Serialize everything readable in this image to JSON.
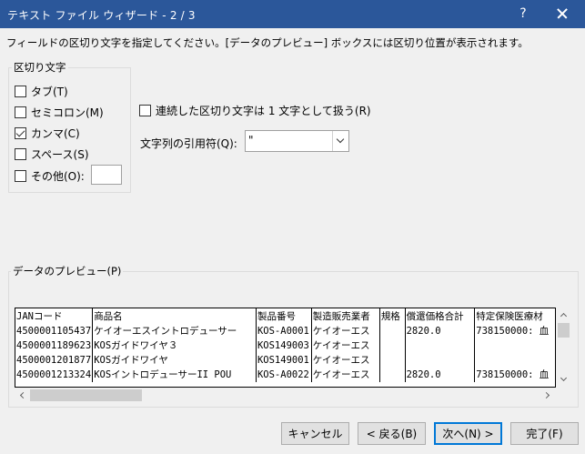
{
  "window": {
    "title": "テキスト ファイル ウィザード - 2 / 3",
    "help_label": "?"
  },
  "instruction": "フィールドの区切り文字を指定してください。[データのプレビュー] ボックスには区切り位置が表示されます。",
  "delimiters": {
    "group_label": "区切り文字",
    "tab": {
      "label": "タブ(T)",
      "checked": false
    },
    "semicolon": {
      "label": "セミコロン(M)",
      "checked": false
    },
    "comma": {
      "label": "カンマ(C)",
      "checked": true
    },
    "space": {
      "label": "スペース(S)",
      "checked": false
    },
    "other": {
      "label": "その他(O):",
      "checked": false,
      "value": ""
    }
  },
  "consecutive": {
    "label": "連続した区切り文字は 1 文字として扱う(R)",
    "checked": false
  },
  "qualifier": {
    "label": "文字列の引用符(Q):",
    "value": "\""
  },
  "preview": {
    "label": "データのプレビュー(P)",
    "rows": [
      [
        "JANコード",
        "商品名",
        "製品番号",
        "製造販売業者",
        "規格",
        "償還価格合計",
        "特定保険医療材"
      ],
      [
        "4500001105437",
        "ケイオーエスイントロデューサー",
        "KOS-A0001",
        "ケイオーエス",
        "",
        "2820.0",
        "738150000: 血"
      ],
      [
        "4500001189623",
        "KOSガイドワイヤ３",
        "KOS149003",
        "ケイオーエス",
        "",
        "",
        ""
      ],
      [
        "4500001201877",
        "KOSガイドワイヤ",
        "KOS149001",
        "ケイオーエス",
        "",
        "",
        ""
      ],
      [
        "4500001213324",
        "KOSイントロデューサーII POU",
        "KOS-A0022",
        "ケイオーエス",
        "",
        "2820.0",
        "738150000: 血"
      ]
    ]
  },
  "buttons": {
    "cancel": "キャンセル",
    "back": "< 戻る(B)",
    "next": "次へ(N) >",
    "finish": "完了(F)"
  }
}
